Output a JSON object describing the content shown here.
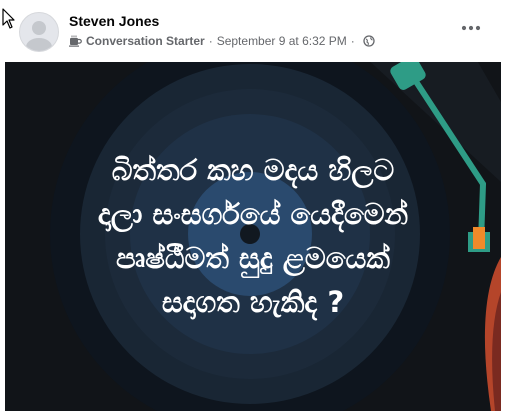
{
  "post": {
    "author": "Steven Jones",
    "badge": "Conversation Starter",
    "badge_icon": "coffee-cup-icon",
    "separator": "·",
    "date": "September 9 at 6:32 PM",
    "separator2": "·",
    "audience_icon": "globe-icon",
    "more_icon": "more-options-icon"
  },
  "image": {
    "caption_lines": [
      "බිත්තර කහ මදය හිලට",
      "දාලා සංසර්ගයේ යෙදීමෙන්",
      "පෘෂ්ඨීමත් සුදු ළමයෙක්",
      "සදාගත හැකිද ?"
    ],
    "colors": {
      "background": "#111418",
      "disc_outer": "#1c2a3a",
      "disc_inner": "#2a4a6e",
      "arm": "#2e9c86",
      "accent": "#f08a2a",
      "text": "#ffffff"
    }
  }
}
